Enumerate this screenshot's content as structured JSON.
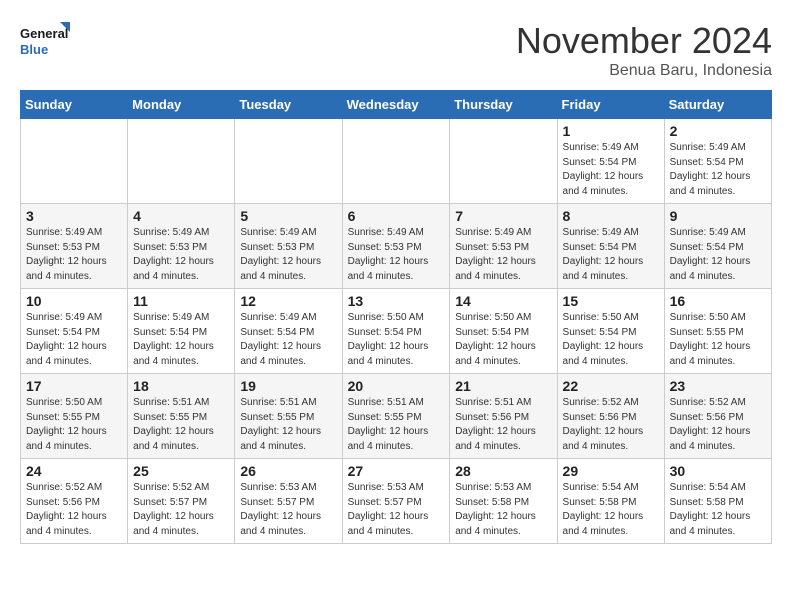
{
  "logo": {
    "text_general": "General",
    "text_blue": "Blue"
  },
  "header": {
    "month_title": "November 2024",
    "location": "Benua Baru, Indonesia"
  },
  "weekdays": [
    "Sunday",
    "Monday",
    "Tuesday",
    "Wednesday",
    "Thursday",
    "Friday",
    "Saturday"
  ],
  "weeks": [
    [
      {
        "day": "",
        "info": ""
      },
      {
        "day": "",
        "info": ""
      },
      {
        "day": "",
        "info": ""
      },
      {
        "day": "",
        "info": ""
      },
      {
        "day": "",
        "info": ""
      },
      {
        "day": "1",
        "info": "Sunrise: 5:49 AM\nSunset: 5:54 PM\nDaylight: 12 hours and 4 minutes."
      },
      {
        "day": "2",
        "info": "Sunrise: 5:49 AM\nSunset: 5:54 PM\nDaylight: 12 hours and 4 minutes."
      }
    ],
    [
      {
        "day": "3",
        "info": "Sunrise: 5:49 AM\nSunset: 5:53 PM\nDaylight: 12 hours and 4 minutes."
      },
      {
        "day": "4",
        "info": "Sunrise: 5:49 AM\nSunset: 5:53 PM\nDaylight: 12 hours and 4 minutes."
      },
      {
        "day": "5",
        "info": "Sunrise: 5:49 AM\nSunset: 5:53 PM\nDaylight: 12 hours and 4 minutes."
      },
      {
        "day": "6",
        "info": "Sunrise: 5:49 AM\nSunset: 5:53 PM\nDaylight: 12 hours and 4 minutes."
      },
      {
        "day": "7",
        "info": "Sunrise: 5:49 AM\nSunset: 5:53 PM\nDaylight: 12 hours and 4 minutes."
      },
      {
        "day": "8",
        "info": "Sunrise: 5:49 AM\nSunset: 5:54 PM\nDaylight: 12 hours and 4 minutes."
      },
      {
        "day": "9",
        "info": "Sunrise: 5:49 AM\nSunset: 5:54 PM\nDaylight: 12 hours and 4 minutes."
      }
    ],
    [
      {
        "day": "10",
        "info": "Sunrise: 5:49 AM\nSunset: 5:54 PM\nDaylight: 12 hours and 4 minutes."
      },
      {
        "day": "11",
        "info": "Sunrise: 5:49 AM\nSunset: 5:54 PM\nDaylight: 12 hours and 4 minutes."
      },
      {
        "day": "12",
        "info": "Sunrise: 5:49 AM\nSunset: 5:54 PM\nDaylight: 12 hours and 4 minutes."
      },
      {
        "day": "13",
        "info": "Sunrise: 5:50 AM\nSunset: 5:54 PM\nDaylight: 12 hours and 4 minutes."
      },
      {
        "day": "14",
        "info": "Sunrise: 5:50 AM\nSunset: 5:54 PM\nDaylight: 12 hours and 4 minutes."
      },
      {
        "day": "15",
        "info": "Sunrise: 5:50 AM\nSunset: 5:54 PM\nDaylight: 12 hours and 4 minutes."
      },
      {
        "day": "16",
        "info": "Sunrise: 5:50 AM\nSunset: 5:55 PM\nDaylight: 12 hours and 4 minutes."
      }
    ],
    [
      {
        "day": "17",
        "info": "Sunrise: 5:50 AM\nSunset: 5:55 PM\nDaylight: 12 hours and 4 minutes."
      },
      {
        "day": "18",
        "info": "Sunrise: 5:51 AM\nSunset: 5:55 PM\nDaylight: 12 hours and 4 minutes."
      },
      {
        "day": "19",
        "info": "Sunrise: 5:51 AM\nSunset: 5:55 PM\nDaylight: 12 hours and 4 minutes."
      },
      {
        "day": "20",
        "info": "Sunrise: 5:51 AM\nSunset: 5:55 PM\nDaylight: 12 hours and 4 minutes."
      },
      {
        "day": "21",
        "info": "Sunrise: 5:51 AM\nSunset: 5:56 PM\nDaylight: 12 hours and 4 minutes."
      },
      {
        "day": "22",
        "info": "Sunrise: 5:52 AM\nSunset: 5:56 PM\nDaylight: 12 hours and 4 minutes."
      },
      {
        "day": "23",
        "info": "Sunrise: 5:52 AM\nSunset: 5:56 PM\nDaylight: 12 hours and 4 minutes."
      }
    ],
    [
      {
        "day": "24",
        "info": "Sunrise: 5:52 AM\nSunset: 5:56 PM\nDaylight: 12 hours and 4 minutes."
      },
      {
        "day": "25",
        "info": "Sunrise: 5:52 AM\nSunset: 5:57 PM\nDaylight: 12 hours and 4 minutes."
      },
      {
        "day": "26",
        "info": "Sunrise: 5:53 AM\nSunset: 5:57 PM\nDaylight: 12 hours and 4 minutes."
      },
      {
        "day": "27",
        "info": "Sunrise: 5:53 AM\nSunset: 5:57 PM\nDaylight: 12 hours and 4 minutes."
      },
      {
        "day": "28",
        "info": "Sunrise: 5:53 AM\nSunset: 5:58 PM\nDaylight: 12 hours and 4 minutes."
      },
      {
        "day": "29",
        "info": "Sunrise: 5:54 AM\nSunset: 5:58 PM\nDaylight: 12 hours and 4 minutes."
      },
      {
        "day": "30",
        "info": "Sunrise: 5:54 AM\nSunset: 5:58 PM\nDaylight: 12 hours and 4 minutes."
      }
    ]
  ]
}
